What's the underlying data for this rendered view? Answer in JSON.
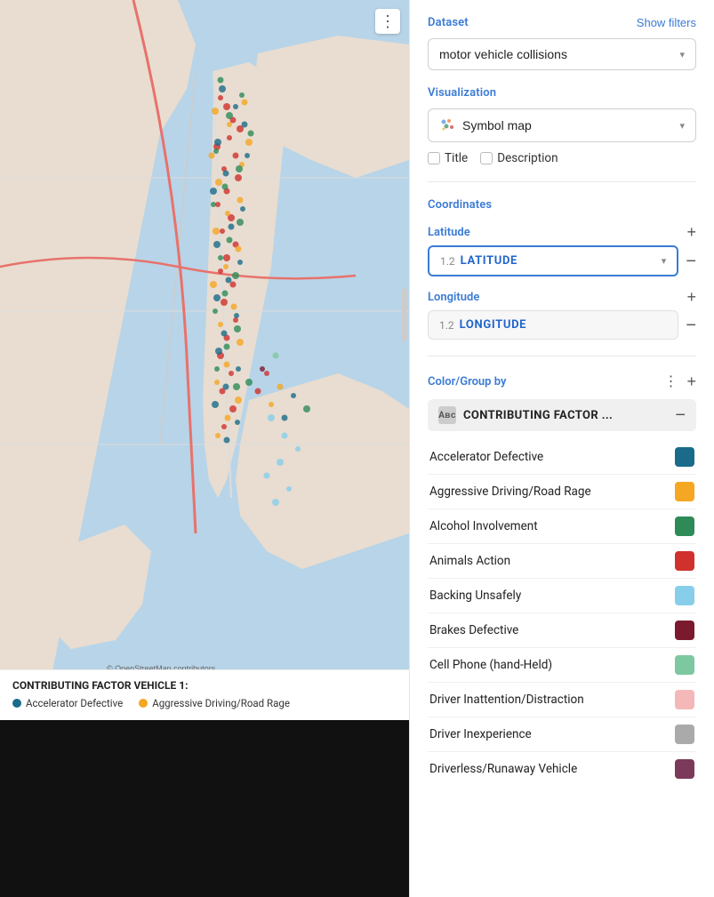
{
  "map": {
    "menu_label": "⋮",
    "legend_title": "CONTRIBUTING FACTOR VEHICLE 1:",
    "legend_items": [
      {
        "label": "Accelerator Defective",
        "color": "#1a6b8a"
      },
      {
        "label": "Aggressive Driving/Road Rage",
        "color": "#f5a623"
      }
    ],
    "copyright": "© OpenStreetMap contributors"
  },
  "right_panel": {
    "dataset_label": "Dataset",
    "show_filters_label": "Show filters",
    "dataset_value": "motor vehicle collisions",
    "visualization_label": "Visualization",
    "visualization_value": "Symbol map",
    "title_checkbox": "Title",
    "description_checkbox": "Description",
    "coordinates_label": "Coordinates",
    "latitude_label": "Latitude",
    "latitude_num": "1.2",
    "latitude_name": "LATITUDE",
    "longitude_label": "Longitude",
    "longitude_num": "1.2",
    "longitude_name": "LONGITUDE",
    "color_group_label": "Color/Group by",
    "contributing_factor_label": "CONTRIBUTING FACTOR ...",
    "legend_items": [
      {
        "label": "Accelerator Defective",
        "color": "#1a6b8a"
      },
      {
        "label": "Aggressive Driving/Road Rage",
        "color": "#f5a623"
      },
      {
        "label": "Alcohol Involvement",
        "color": "#2e8b57"
      },
      {
        "label": "Animals Action",
        "color": "#d0312d"
      },
      {
        "label": "Backing Unsafely",
        "color": "#87ceeb"
      },
      {
        "label": "Brakes Defective",
        "color": "#7b1a2e"
      },
      {
        "label": "Cell Phone (hand-Held)",
        "color": "#7ec8a0"
      },
      {
        "label": "Driver Inattention/Distraction",
        "color": "#f4b8b8"
      },
      {
        "label": "Driver Inexperience",
        "color": "#aaaaaa"
      },
      {
        "label": "Driverless/Runaway Vehicle",
        "color": "#7b3a5a"
      }
    ]
  }
}
